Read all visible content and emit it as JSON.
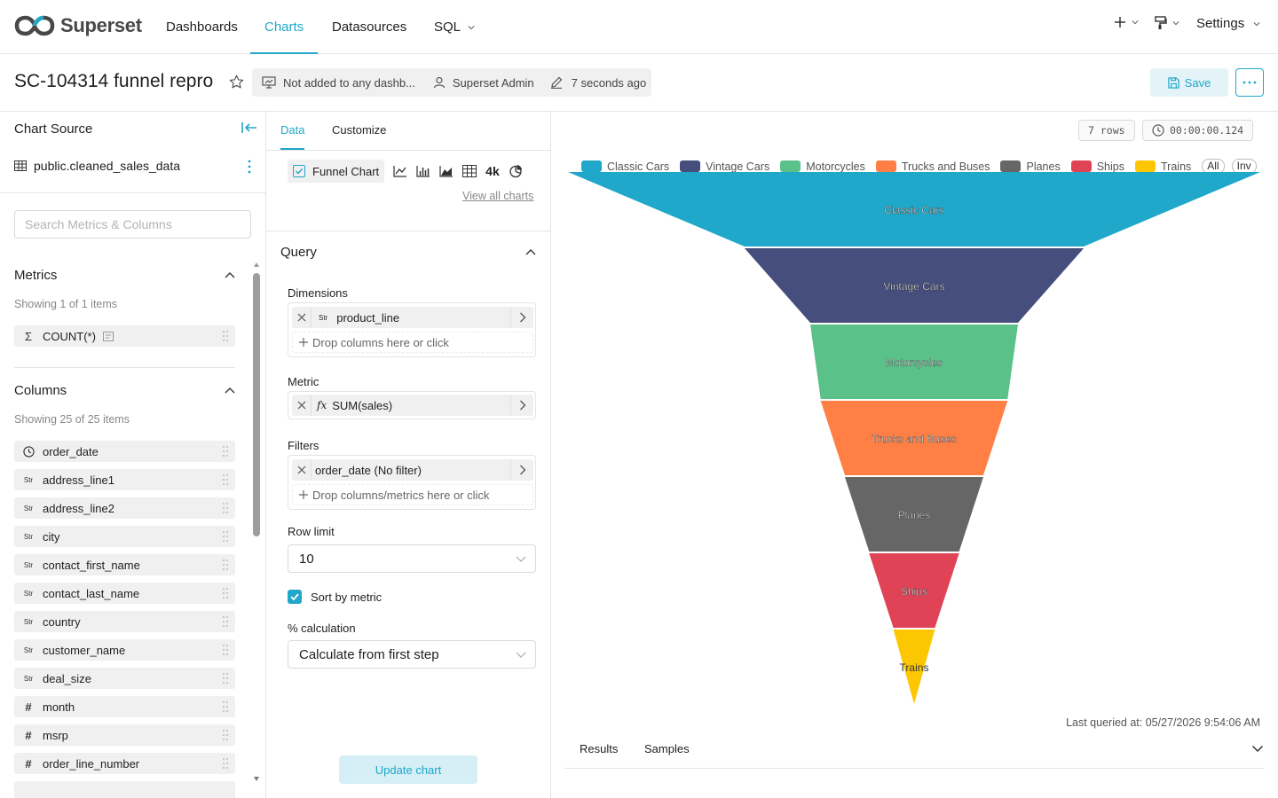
{
  "nav": {
    "logo_text": "Superset",
    "items": [
      {
        "label": "Dashboards",
        "active": false
      },
      {
        "label": "Charts",
        "active": true
      },
      {
        "label": "Datasources",
        "active": false
      },
      {
        "label": "SQL",
        "active": false
      }
    ],
    "settings_label": "Settings"
  },
  "titlebar": {
    "chart_title": "SC-104314 funnel repro",
    "dashboards_text": "Not added to any dashb...",
    "owner_text": "Superset Admin",
    "modified_text": "7 seconds ago",
    "save_label": "Save"
  },
  "left_panel": {
    "title": "Chart Source",
    "dataset_name": "public.cleaned_sales_data",
    "search_placeholder": "Search Metrics & Columns",
    "metrics": {
      "heading": "Metrics",
      "showing": "Showing 1 of 1 items",
      "items": [
        {
          "type": "sigma",
          "name": "COUNT(*)"
        }
      ]
    },
    "columns": {
      "heading": "Columns",
      "showing": "Showing 25 of 25 items",
      "items": [
        {
          "type": "time",
          "name": "order_date"
        },
        {
          "type": "str",
          "name": "address_line1"
        },
        {
          "type": "str",
          "name": "address_line2"
        },
        {
          "type": "str",
          "name": "city"
        },
        {
          "type": "str",
          "name": "contact_first_name"
        },
        {
          "type": "str",
          "name": "contact_last_name"
        },
        {
          "type": "str",
          "name": "country"
        },
        {
          "type": "str",
          "name": "customer_name"
        },
        {
          "type": "str",
          "name": "deal_size"
        },
        {
          "type": "num",
          "name": "month"
        },
        {
          "type": "num",
          "name": "msrp"
        },
        {
          "type": "num",
          "name": "order_line_number"
        }
      ]
    }
  },
  "control_panel": {
    "tabs": [
      {
        "label": "Data",
        "active": true
      },
      {
        "label": "Customize",
        "active": false
      }
    ],
    "viz_type": "Funnel Chart",
    "big_number_label": "4k",
    "view_all_charts": "View all charts",
    "query_heading": "Query",
    "dimensions_label": "Dimensions",
    "dimension_value": "product_line",
    "dimension_type_tag": "Str",
    "drop_columns_text": "Drop columns here or click",
    "metric_label": "Metric",
    "metric_value": "SUM(sales)",
    "filters_label": "Filters",
    "filter_value": "order_date (No filter)",
    "drop_filters_text": "Drop columns/metrics here or click",
    "row_limit_label": "Row limit",
    "row_limit_value": "10",
    "sort_by_metric_label": "Sort by metric",
    "sort_by_metric_checked": true,
    "percent_calc_label": "% calculation",
    "percent_calc_value": "Calculate from first step",
    "update_button": "Update chart"
  },
  "chart_panel": {
    "rows_badge": "7 rows",
    "timer_badge": "00:00:00.124",
    "legend_all": "All",
    "legend_inv": "Inv",
    "last_queried": "Last queried at: 05/27/2026 9:54:06 AM",
    "bottom_tabs": [
      "Results",
      "Samples"
    ]
  },
  "colors": {
    "accent": "#20a7c9"
  },
  "chart_data": {
    "type": "funnel",
    "sort": "descending",
    "categories": [
      "Classic Cars",
      "Vintage Cars",
      "Motorcycles",
      "Trucks and Buses",
      "Planes",
      "Ships",
      "Trains"
    ],
    "relative_widths": [
      1.0,
      0.49,
      0.3,
      0.27,
      0.2,
      0.13,
      0.06
    ],
    "colors": [
      "#1FA8C9",
      "#454E7C",
      "#5AC189",
      "#FF7F44",
      "#666666",
      "#E04355",
      "#FCC700"
    ],
    "legend_position": "top"
  }
}
